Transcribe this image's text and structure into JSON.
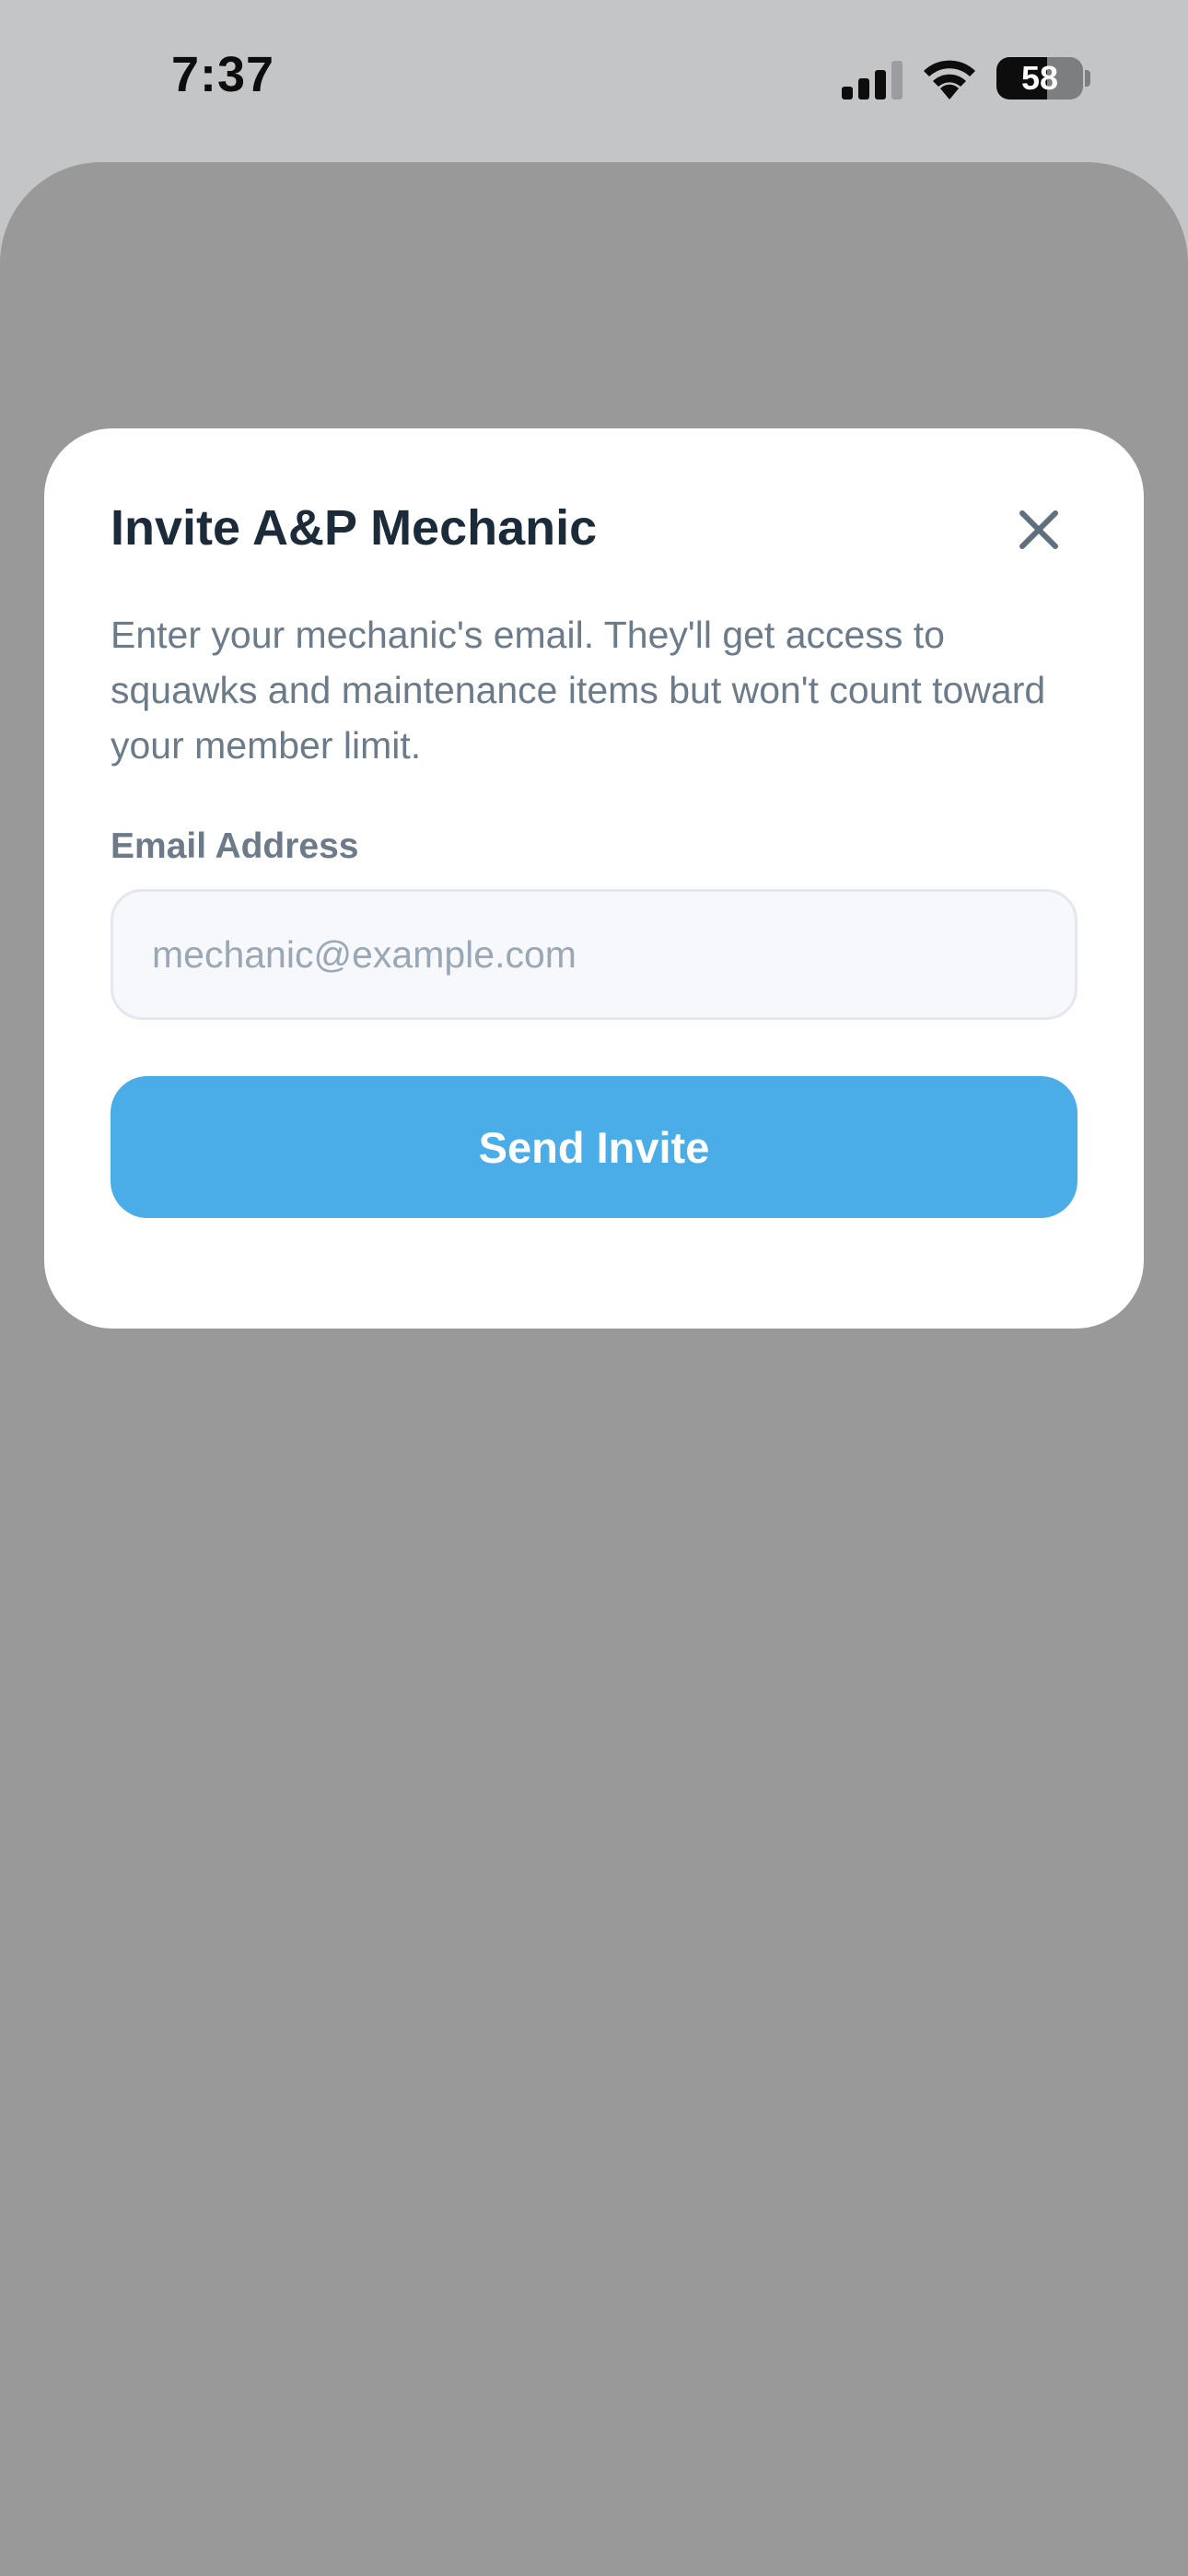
{
  "status_bar": {
    "time": "7:37",
    "battery_level": "58",
    "icons": [
      "signal-icon",
      "wifi-icon",
      "battery-icon"
    ]
  },
  "modal": {
    "title": "Invite A&P Mechanic",
    "close_icon": "close-icon",
    "description": "Enter your mechanic's email. They'll get access to squawks and maintenance items but won't count toward your member limit.",
    "email_label": "Email Address",
    "email_placeholder": "mechanic@example.com",
    "email_value": "",
    "send_label": "Send Invite"
  },
  "colors": {
    "accent": "#4aade7",
    "title": "#1c2b3a",
    "body_text": "#6b7b8a",
    "backdrop": "#999999",
    "status_bar_bg": "#c4c5c7"
  }
}
